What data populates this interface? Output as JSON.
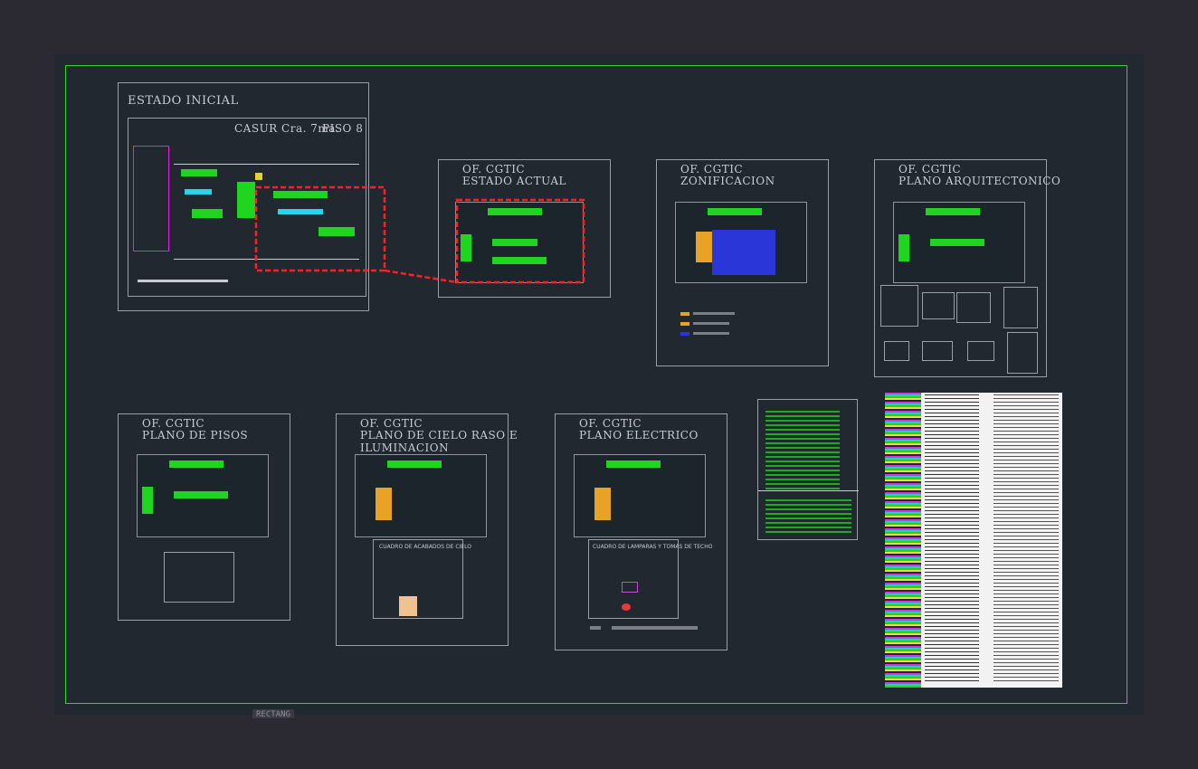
{
  "sheets": {
    "estado_inicial": {
      "title": "ESTADO INICIAL",
      "subtitle": "CASUR Cra. 7ma.",
      "floor": "PISO 8"
    },
    "estado_actual": {
      "title1": "OF.   CGTIC",
      "title2": "ESTADO ACTUAL"
    },
    "zonificacion": {
      "title1": "OF.   CGTIC",
      "title2": "ZONIFICACION"
    },
    "plano_arquitectonico": {
      "title1": "OF.   CGTIC",
      "title2": "PLANO ARQUITECTONICO"
    },
    "plano_pisos": {
      "title1": "OF.   CGTIC",
      "title2": "PLANO DE PISOS"
    },
    "plano_cielo": {
      "title1": "OF.   CGTIC",
      "title2": "PLANO DE CIELO RASO E",
      "title3": "ILUMINACION",
      "table_title": "CUADRO DE ACABADOS DE CIELO"
    },
    "plano_electrico": {
      "title1": "OF.   CGTIC",
      "title2": "PLANO ELECTRICO",
      "table_title": "CUADRO DE LAMPARAS Y TOMAS DE TECHO"
    }
  },
  "command_line": {
    "text": "RECTANG"
  },
  "colors": {
    "background": "#2b2a33",
    "model_space": "#212830",
    "border": "#2fd42f",
    "highlight": "#ff1f1f"
  }
}
